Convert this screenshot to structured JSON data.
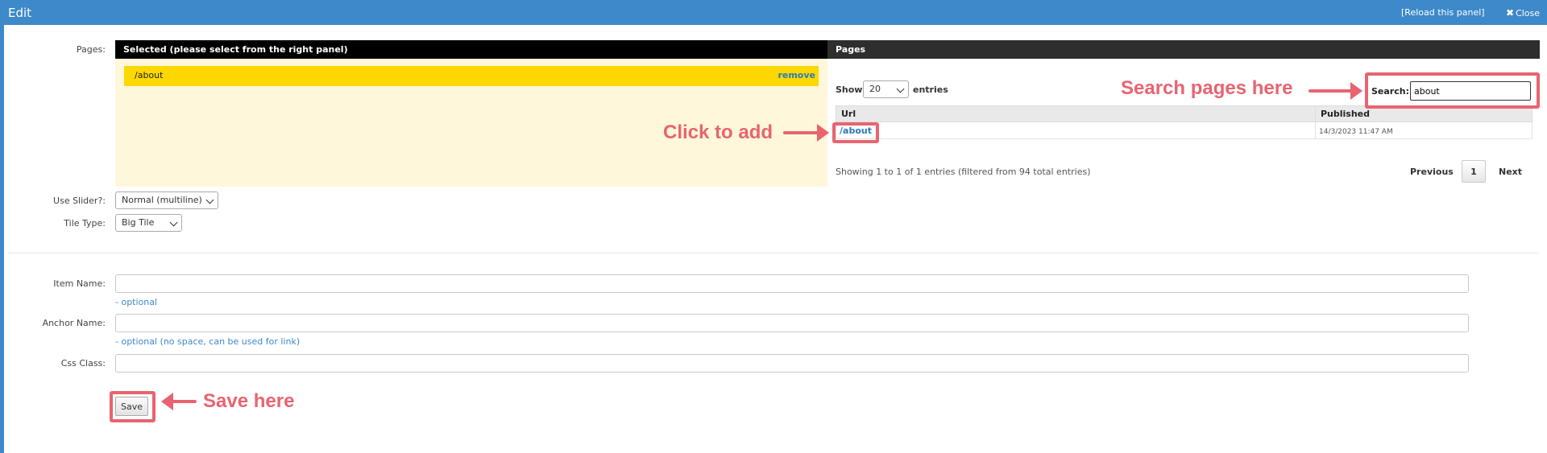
{
  "window": {
    "title": "Edit",
    "reload_label": "[Reload this panel]",
    "close_label": "Close"
  },
  "labels": {
    "pages": "Pages:",
    "use_slider": "Use Slider?:",
    "tile_type": "Tile Type:",
    "item_name": "Item Name:",
    "anchor_name": "Anchor Name:",
    "css_class": "Css Class:"
  },
  "selected_panel": {
    "header": "Selected (please select from the right panel)",
    "items": [
      {
        "url": "/about",
        "remove_label": "remove"
      }
    ]
  },
  "pages_panel": {
    "header": "Pages",
    "show_label": "Show",
    "page_size": "20",
    "entries_label": "entries",
    "search_label": "Search:",
    "search_value": "about",
    "columns": [
      "Url",
      "Published"
    ],
    "rows": [
      {
        "url": "/about",
        "published": "14/3/2023 11:47 AM"
      }
    ],
    "info": "Showing 1 to 1 of 1 entries (filtered from 94 total entries)",
    "pagination": {
      "previous": "Previous",
      "current": "1",
      "next": "Next"
    }
  },
  "fields": {
    "use_slider_value": "Normal (multiline)",
    "tile_type_value": "Big Tile",
    "item_name_hint": "- optional",
    "anchor_name_hint": "- optional (no space, can be used for link)",
    "save_label": "Save"
  },
  "annotations": {
    "search": "Search pages here",
    "click": "Click to add",
    "save": "Save here",
    "color": "#e86470"
  },
  "colors": {
    "titlebar": "#3d89c9",
    "selected_bg": "#fff7da",
    "selected_item": "#ffd700",
    "link": "#2a7ab8"
  }
}
